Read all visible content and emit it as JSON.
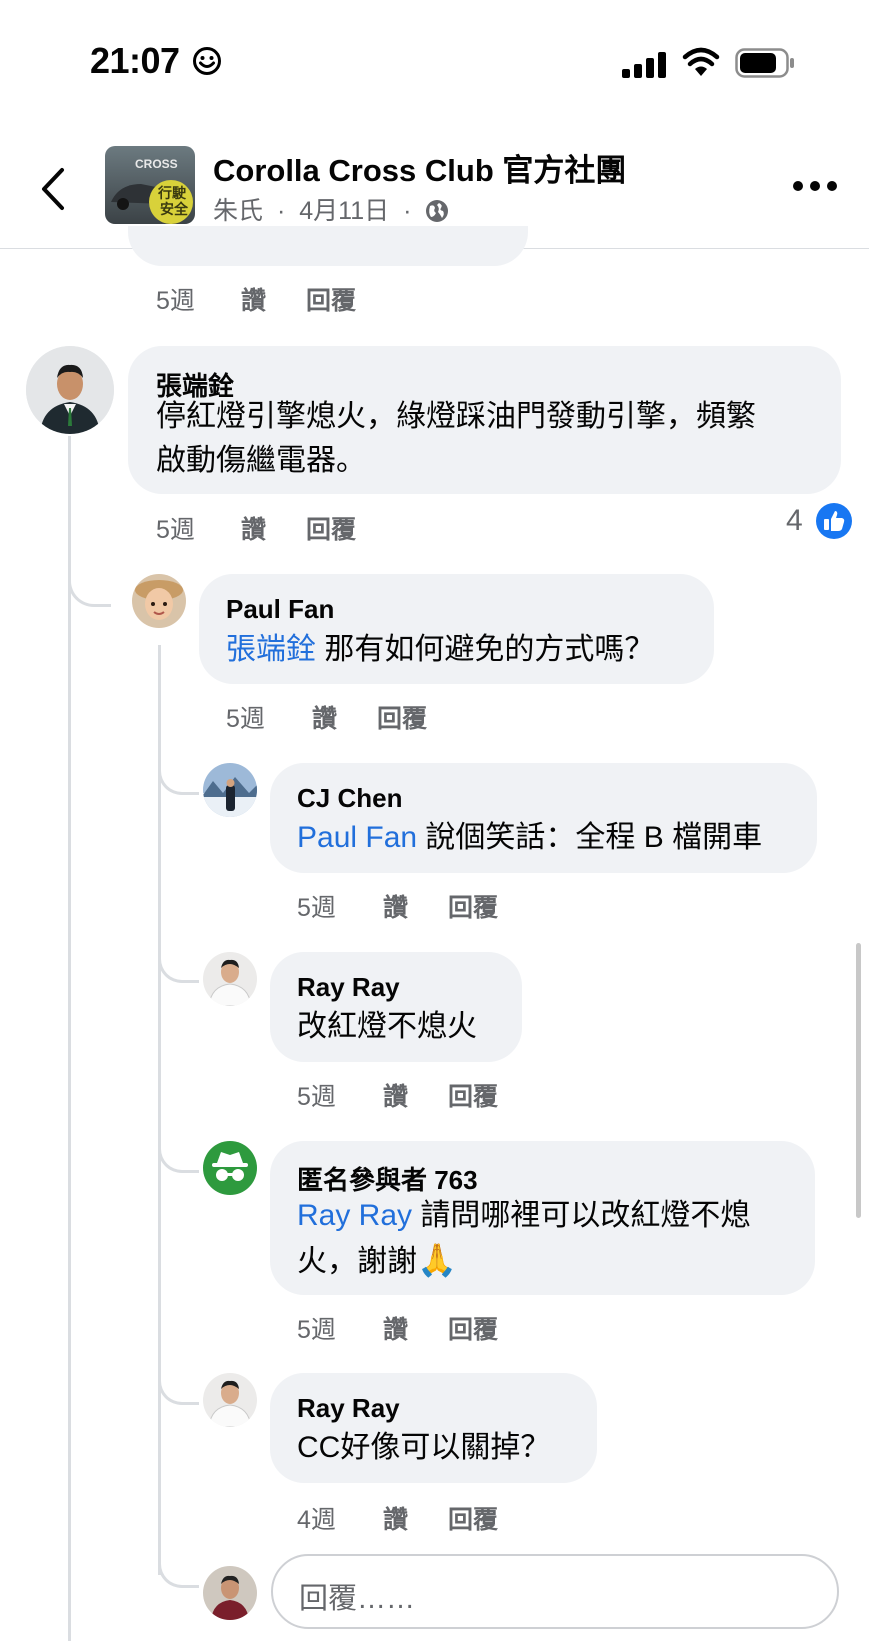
{
  "status_bar": {
    "time": "21:07"
  },
  "header": {
    "group_name": "Corolla Cross Club 官方社團",
    "author": "朱氏",
    "date": "4月11日",
    "separator": "·"
  },
  "top_actions": {
    "time": "5週",
    "like": "讚",
    "reply": "回覆"
  },
  "comments": [
    {
      "name": "張端銓",
      "lines": [
        "停紅燈引擎熄火，綠燈踩油門發動引擎，頻繁",
        "啟動傷繼電器。"
      ],
      "time": "5週",
      "like": "讚",
      "reply": "回覆",
      "reaction_count": "4"
    },
    {
      "name": "Paul Fan",
      "mention": "張端銓",
      "text": " 那有如何避免的方式嗎？",
      "time": "5週",
      "like": "讚",
      "reply": "回覆"
    },
    {
      "name": "CJ Chen",
      "mention": "Paul Fan",
      "text": " 說個笑話：全程 B 檔開車",
      "time": "5週",
      "like": "讚",
      "reply": "回覆"
    },
    {
      "name": "Ray Ray",
      "text": "改紅燈不熄火",
      "time": "5週",
      "like": "讚",
      "reply": "回覆"
    },
    {
      "name": "匿名參與者 763",
      "mention": "Ray Ray",
      "text": " 請問哪裡可以改紅燈不熄",
      "text2": "火，謝謝",
      "emoji": "🙏",
      "time": "5週",
      "like": "讚",
      "reply": "回覆"
    },
    {
      "name": "Ray Ray",
      "text": "CC好像可以關掉？",
      "time": "4週",
      "like": "讚",
      "reply": "回覆"
    }
  ],
  "reply_input": {
    "placeholder": "回覆……"
  },
  "colors": {
    "accent": "#216fdb",
    "like": "#1877f2",
    "anon": "#2e9a3e"
  }
}
